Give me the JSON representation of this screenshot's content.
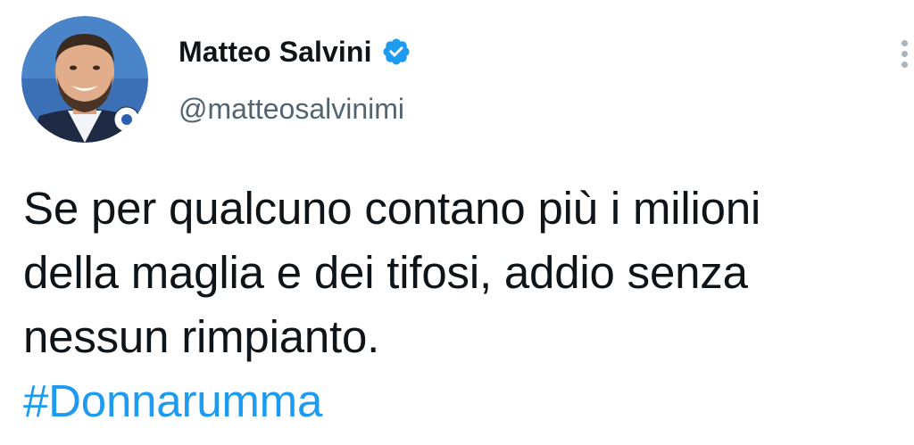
{
  "author": {
    "display_name": "Matteo Salvini",
    "handle": "@matteosalvinimi",
    "verified_icon": "verified-badge-icon",
    "avatar_icon": "profile-photo"
  },
  "tweet": {
    "lines": [
      "Se per qualcuno contano più i milioni",
      "della maglia e dei tifosi, addio senza",
      "nessun rimpianto."
    ],
    "hashtag": "#Donnarumma"
  },
  "colors": {
    "text": "#0f1419",
    "secondary": "#536471",
    "link": "#1d9bf0",
    "verified": "#1d9bf0"
  }
}
